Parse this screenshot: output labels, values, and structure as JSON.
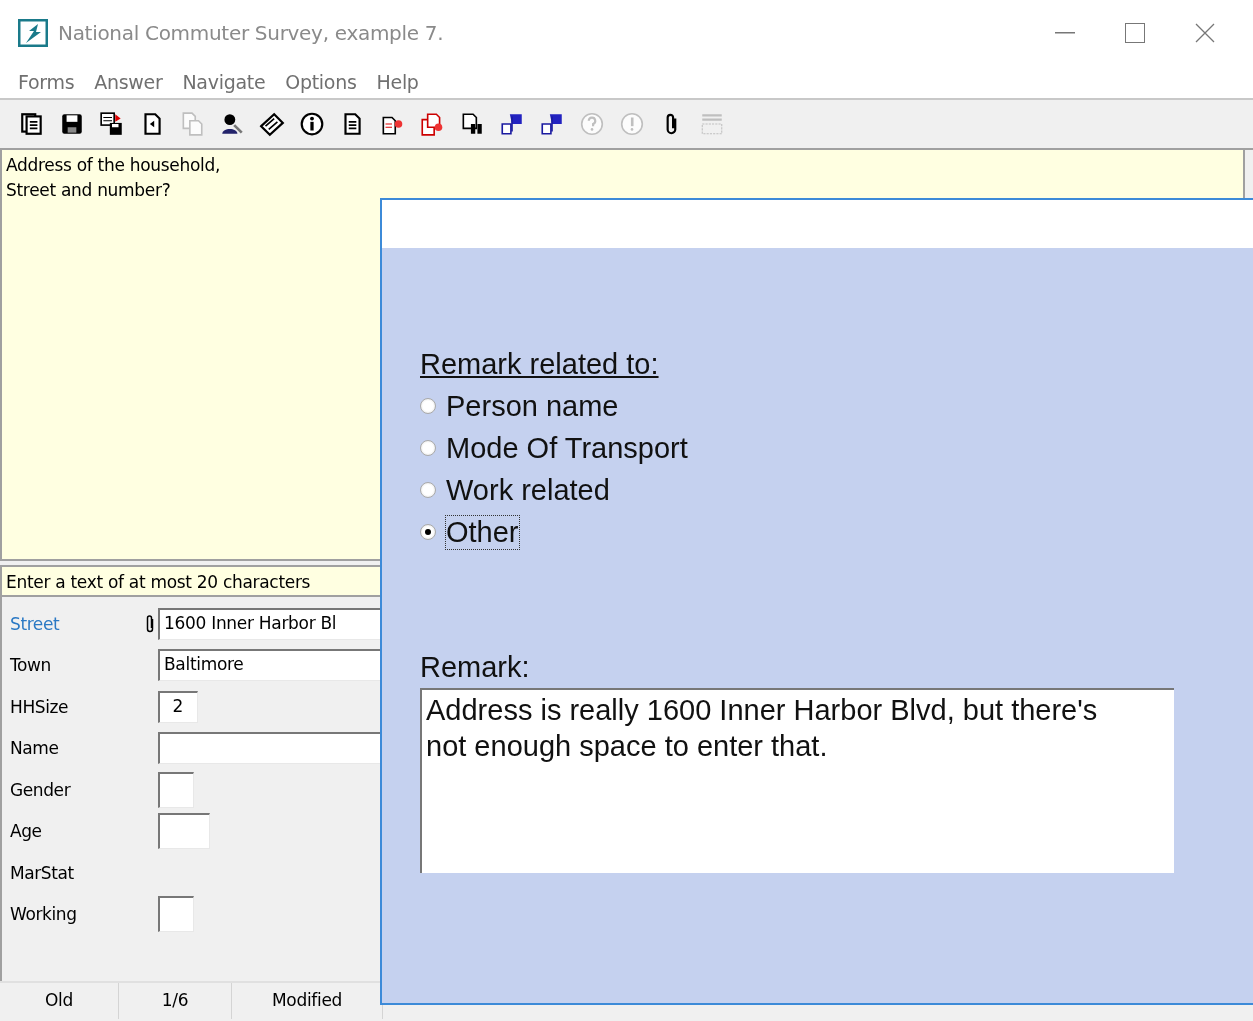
{
  "window": {
    "title": "National Commuter Survey, example 7."
  },
  "menu": [
    "Forms",
    "Answer",
    "Navigate",
    "Options",
    "Help"
  ],
  "toolbar": [
    {
      "kind": "forms",
      "disabled": false
    },
    {
      "kind": "save",
      "disabled": false
    },
    {
      "kind": "saveas",
      "disabled": false
    },
    {
      "kind": "page",
      "disabled": false
    },
    {
      "kind": "copy",
      "disabled": true
    },
    {
      "kind": "person",
      "disabled": false
    },
    {
      "kind": "keyboard",
      "disabled": false
    },
    {
      "kind": "info",
      "disabled": false
    },
    {
      "kind": "doc",
      "disabled": false
    },
    {
      "kind": "docx",
      "disabled": false
    },
    {
      "kind": "docsx",
      "disabled": false
    },
    {
      "kind": "binoc",
      "disabled": false
    },
    {
      "kind": "flag",
      "disabled": false
    },
    {
      "kind": "flag",
      "disabled": false
    },
    {
      "kind": "help",
      "disabled": true
    },
    {
      "kind": "alert",
      "disabled": true
    },
    {
      "kind": "clip",
      "disabled": false
    },
    {
      "kind": "lines",
      "disabled": true
    }
  ],
  "question": {
    "lines": [
      "Address of the household,",
      "Street and number?"
    ]
  },
  "hint": "Enter a text of at most 20 characters",
  "fields": [
    {
      "label": "Street",
      "kind": "text",
      "value": "1600 Inner Harbor Bl",
      "active": true,
      "remark": true
    },
    {
      "label": "Town",
      "kind": "text",
      "value": "Baltimore",
      "active": false,
      "remark": false
    },
    {
      "label": "HHSize",
      "kind": "number",
      "value": "2",
      "active": false,
      "remark": false
    },
    {
      "label": "Name",
      "kind": "text",
      "active": false,
      "remark": false
    },
    {
      "label": "Gender",
      "kind": "box",
      "active": false,
      "remark": false
    },
    {
      "label": "Age",
      "kind": "short",
      "active": false,
      "remark": false
    },
    {
      "label": "MarStat",
      "kind": "none",
      "active": false,
      "remark": false
    },
    {
      "label": "Working",
      "kind": "box",
      "active": false,
      "remark": false
    }
  ],
  "status_bar": [
    "Old",
    "1/6",
    "Modified"
  ],
  "dialog": {
    "prompt": "Remark related to:",
    "options": [
      {
        "label": "Person name",
        "selected": false
      },
      {
        "label": "Mode Of Transport",
        "selected": false
      },
      {
        "label": "Work related",
        "selected": false
      },
      {
        "label": "Other",
        "selected": true
      }
    ],
    "remark_label": "Remark:",
    "remark": "Address is really 1600 Inner Harbor Blvd, but there's not enough space to enter that."
  }
}
